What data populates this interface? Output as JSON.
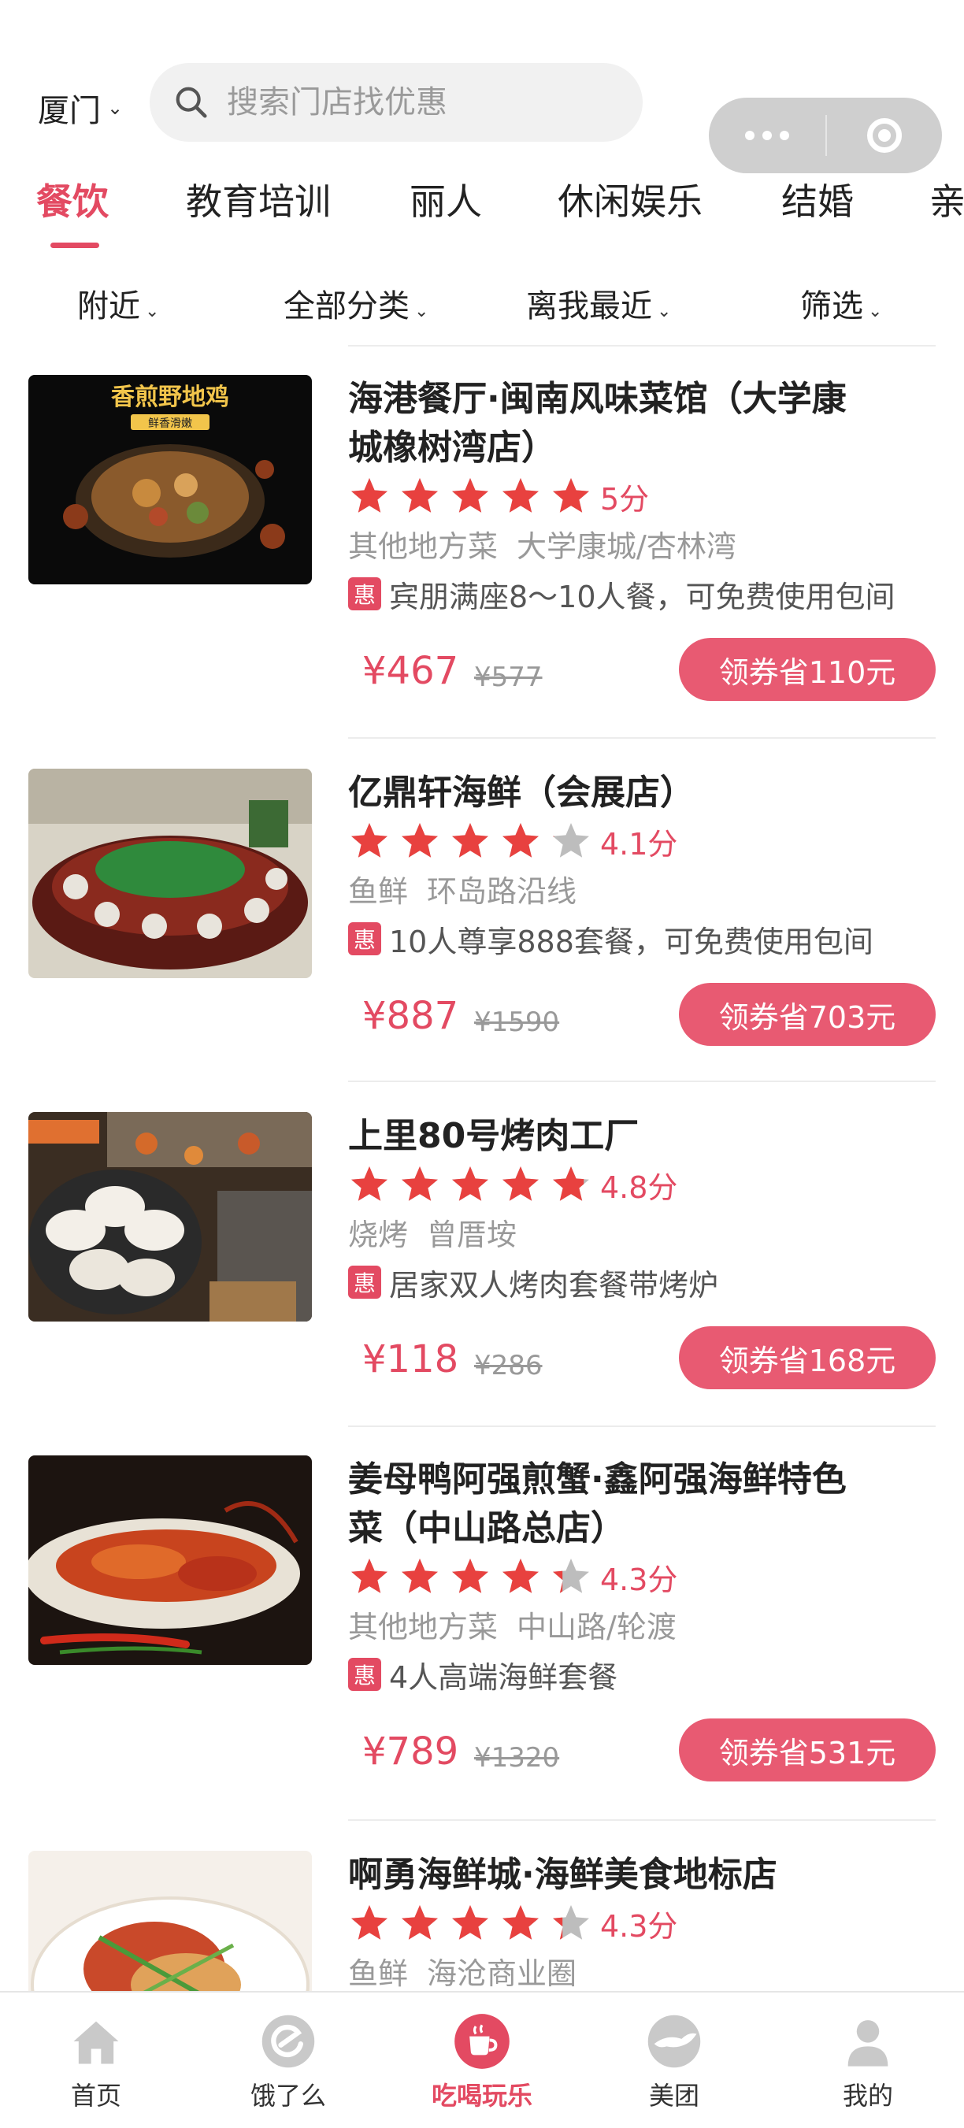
{
  "header": {
    "city": "厦门",
    "search_placeholder": "搜索门店找优惠"
  },
  "tabs": [
    "餐饮",
    "教育培训",
    "丽人",
    "休闲娱乐",
    "结婚",
    "亲"
  ],
  "active_tab": "餐饮",
  "filters": [
    "附近",
    "全部分类",
    "离我最近",
    "筛选"
  ],
  "listings": [
    {
      "name_lines": [
        "海港餐厅·闽南风味菜馆（大学康",
        "城橡树湾店）"
      ],
      "rating": 5,
      "score": "5分",
      "cuisine": "其他地方菜",
      "area": "大学康城/杏林湾",
      "promo_badge": "惠",
      "promo": "宾朋满座8～10人餐，可免费使用包间",
      "price": "¥467",
      "original_price": "¥577",
      "coupon": "领券省110元",
      "image_caption": "香煎野地鸡",
      "image_subcaption": "鲜香滑嫩"
    },
    {
      "name_lines": [
        "亿鼎轩海鲜（会展店）"
      ],
      "rating": 4.1,
      "score": "4.1分",
      "cuisine": "鱼鲜",
      "area": "环岛路沿线",
      "promo_badge": "惠",
      "promo": "10人尊享888套餐，可免费使用包间",
      "price": "¥887",
      "original_price": "¥1590",
      "coupon": "领券省703元"
    },
    {
      "name_lines": [
        "上里80号烤肉工厂"
      ],
      "rating": 4.8,
      "score": "4.8分",
      "cuisine": "烧烤",
      "area": "曾厝垵",
      "promo_badge": "惠",
      "promo": "居家双人烤肉套餐带烤炉",
      "price": "¥118",
      "original_price": "¥286",
      "coupon": "领券省168元"
    },
    {
      "name_lines": [
        "姜母鸭阿强煎蟹·鑫阿强海鲜特色",
        "菜（中山路总店）"
      ],
      "rating": 4.3,
      "score": "4.3分",
      "cuisine": "其他地方菜",
      "area": "中山路/轮渡",
      "promo_badge": "惠",
      "promo": "4人高端海鲜套餐",
      "price": "¥789",
      "original_price": "¥1320",
      "coupon": "领券省531元"
    },
    {
      "name_lines": [
        "啊勇海鲜城·海鲜美食地标店"
      ],
      "rating": 4.3,
      "score": "4.3分",
      "cuisine": "鱼鲜",
      "area": "海沧商业圈"
    }
  ],
  "tabbar": [
    {
      "label": "首页",
      "icon": "home-icon"
    },
    {
      "label": "饿了么",
      "icon": "eleme-icon"
    },
    {
      "label": "吃喝玩乐",
      "icon": "coffee-cup-icon"
    },
    {
      "label": "美团",
      "icon": "meituan-kangaroo-icon"
    },
    {
      "label": "我的",
      "icon": "profile-icon"
    }
  ],
  "tabbar_active": "吃喝玩乐",
  "colors": {
    "accent": "#e34a62",
    "coupon_bg": "#e85a72",
    "star_on": "#e8413f",
    "star_off": "#bdbdbd",
    "muted": "#999999"
  }
}
